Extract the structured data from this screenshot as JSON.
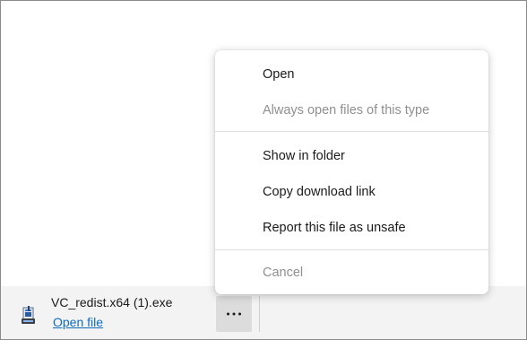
{
  "download": {
    "file_name": "VC_redist.x64 (1).exe",
    "open_link": "Open file",
    "file_icon": "installer-file-icon",
    "more_icon": "more-options-ellipsis-icon"
  },
  "menu": {
    "items": [
      {
        "label": "Open",
        "enabled": true
      },
      {
        "label": "Always open files of this type",
        "enabled": false
      },
      {
        "label": "Show in folder",
        "enabled": true
      },
      {
        "label": "Copy download link",
        "enabled": true
      },
      {
        "label": "Report this file as unsafe",
        "enabled": true
      },
      {
        "label": "Cancel",
        "enabled": false
      }
    ]
  },
  "colors": {
    "link": "#0f6cbd",
    "text": "#1b1b1b",
    "disabled_text": "#8f8f8f",
    "bar_background": "#f3f3f3",
    "active_button": "#dcdcdc"
  }
}
